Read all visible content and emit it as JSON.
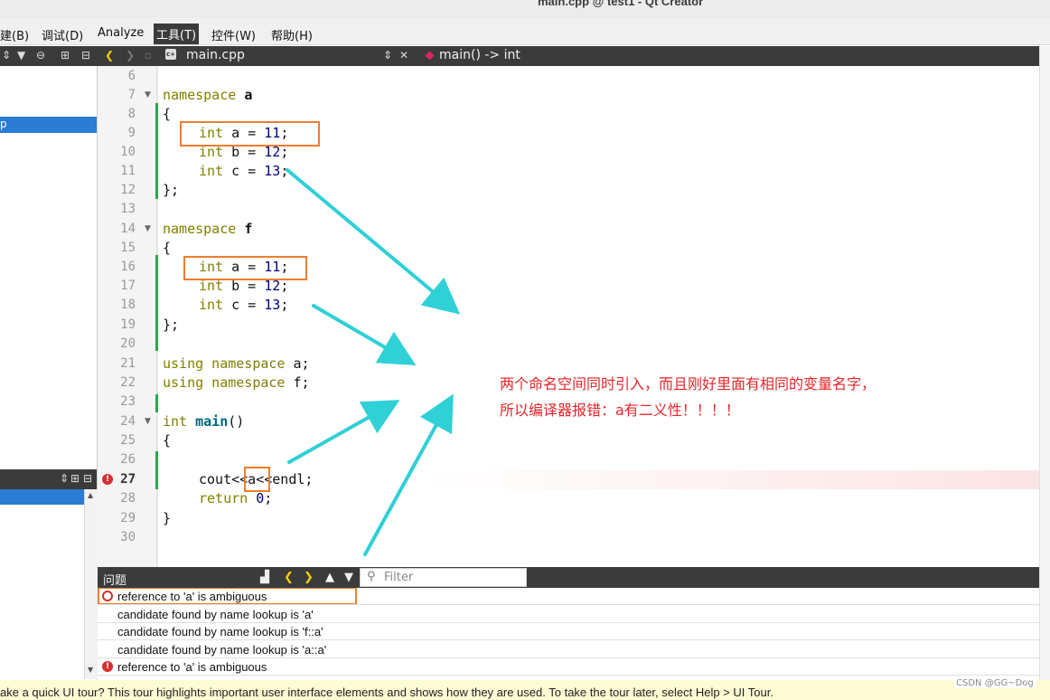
{
  "window": {
    "title": "main.cpp @ test1 - Qt Creator"
  },
  "menubar": {
    "items": [
      {
        "label": "建(B)"
      },
      {
        "label": "调试(D)"
      },
      {
        "label": "Analyze"
      },
      {
        "label": "工具(T)"
      },
      {
        "label": "控件(W)"
      },
      {
        "label": "帮助(H)"
      }
    ]
  },
  "toolbar": {
    "file_name": "main.cpp",
    "function": "main() -> int"
  },
  "sidebar": {
    "selected_item": "p"
  },
  "editor": {
    "line_numbers": [
      "6",
      "7",
      "8",
      "9",
      "10",
      "11",
      "12",
      "13",
      "14",
      "15",
      "16",
      "17",
      "18",
      "19",
      "20",
      "21",
      "22",
      "23",
      "24",
      "25",
      "26",
      "27",
      "28",
      "29",
      "30"
    ],
    "lines": {
      "l7_kw": "namespace ",
      "l7_name": "a",
      "l8": "{",
      "l9_kw": "int",
      "l9_mid": " a = ",
      "l9_num": "11",
      "l9_end": ";",
      "l10_kw": "int",
      "l10_mid": " b = ",
      "l10_num": "12",
      "l10_end": ";",
      "l11_kw": "int",
      "l11_mid": " c = ",
      "l11_num": "13",
      "l11_end": ";",
      "l12": "};",
      "l14_kw": "namespace ",
      "l14_name": "f",
      "l15": "{",
      "l16_kw": "int",
      "l16_mid": " a = ",
      "l16_num": "11",
      "l16_end": ";",
      "l17_kw": "int",
      "l17_mid": " b = ",
      "l17_num": "12",
      "l17_end": ";",
      "l18_kw": "int",
      "l18_mid": " c = ",
      "l18_num": "13",
      "l18_end": ";",
      "l19": "};",
      "l21_kw": "using namespace ",
      "l21_end": "a;",
      "l22_kw": "using namespace ",
      "l22_end": "f;",
      "l24_kw": "int ",
      "l24_fn": "main",
      "l24_end": "()",
      "l25": "{",
      "l27": "cout<<a<<endl;",
      "l28_kw": "return ",
      "l28_num": "0",
      "l28_end": ";",
      "l29": "}"
    }
  },
  "annotation": {
    "line1": "两个命名空间同时引入，而且刚好里面有相同的变量名字，",
    "line2": "所以编译器报错：a有二义性！！！！"
  },
  "issues": {
    "title": "问题",
    "filter_placeholder": "Filter",
    "rows": [
      {
        "text": "reference to 'a' is ambiguous",
        "type": "error"
      },
      {
        "text": "candidate found by name lookup is 'a'",
        "type": "note"
      },
      {
        "text": "candidate found by name lookup is 'f::a'",
        "type": "note"
      },
      {
        "text": "candidate found by name lookup is 'a::a'",
        "type": "note"
      },
      {
        "text": "reference to 'a' is ambiguous",
        "type": "error"
      }
    ]
  },
  "statusbar": {
    "message": "ake a quick UI tour? This tour highlights important user interface elements and shows how they are used. To take the tour later, select Help > UI Tour."
  },
  "watermark": "CSDN @GG~Dog",
  "colors": {
    "accent": "#2b7cd3",
    "highlight_box": "#ef7e2c",
    "arrow": "#2fd0d6",
    "note_text": "#e3262a",
    "error": "#d62f2f"
  }
}
